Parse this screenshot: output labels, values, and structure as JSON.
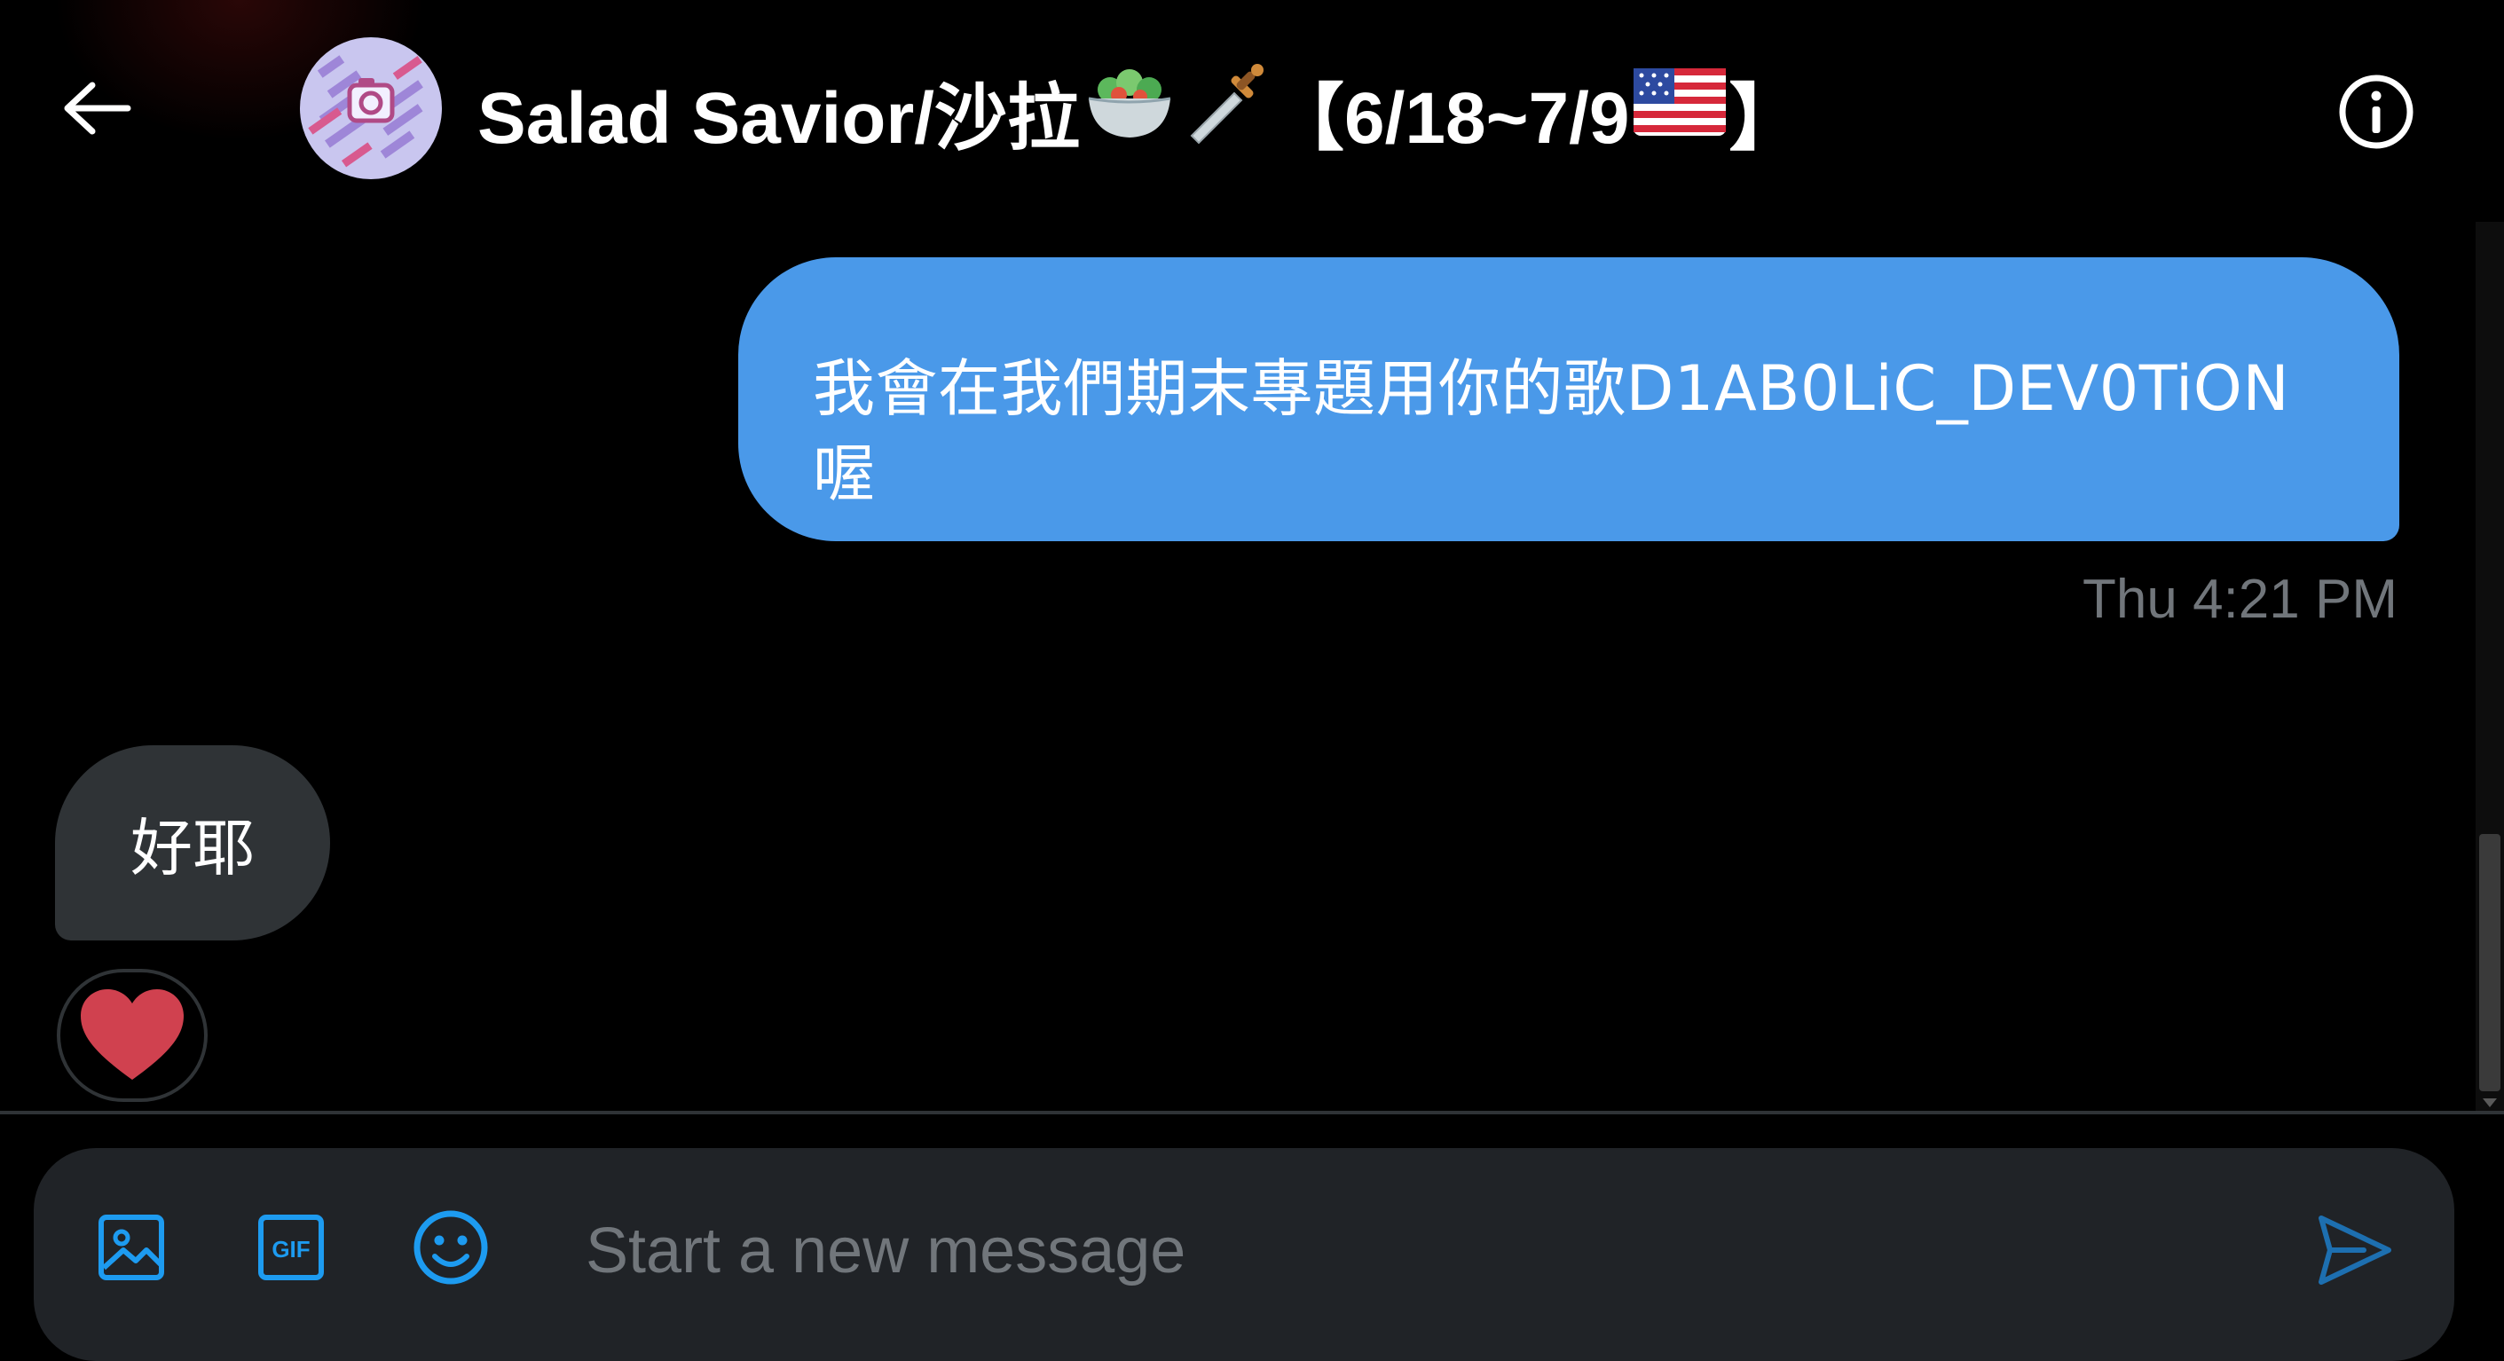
{
  "header": {
    "back_icon": "arrow-left-icon",
    "avatar_icon": "striped-camera-avatar",
    "title_text_1": "Salad Savior/沙拉",
    "title_emoji_1": "salad-emoji",
    "title_emoji_2": "dagger-emoji",
    "title_text_2": "【6/18~7/9",
    "title_emoji_3": "us-flag-emoji",
    "title_text_3": "】",
    "info_icon": "info-circle-icon"
  },
  "messages": [
    {
      "direction": "outgoing",
      "line1": "我會在我們期末專題用你的歌D1AB0LiC_DEV0TiON",
      "line2": "喔",
      "timestamp": "Thu 4:21 PM"
    },
    {
      "direction": "incoming",
      "text": "好耶",
      "reaction": "heart-emoji"
    }
  ],
  "composer": {
    "placeholder": "Start a new message",
    "value": "",
    "tools": [
      "image-icon",
      "gif-icon",
      "emoji-icon"
    ],
    "send_icon": "send-icon"
  },
  "colors": {
    "background": "#000000",
    "outgoing_bubble": "#4a99e9",
    "incoming_bubble": "#2f3336",
    "composer_bg": "#202327",
    "accent": "#1d9bf0",
    "muted_text": "#71767b",
    "heart": "#d0414f"
  }
}
